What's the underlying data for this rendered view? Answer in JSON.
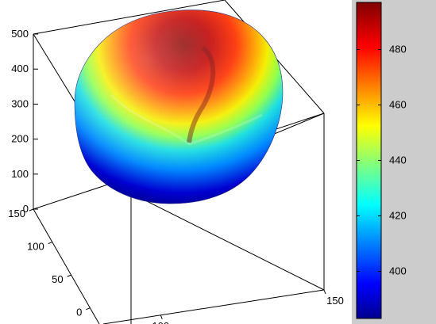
{
  "chart_data": {
    "type": "surface-3d",
    "title": "",
    "grid": false,
    "colormap": "jet",
    "z_axis": {
      "ticks": [
        "0",
        "100",
        "200",
        "300",
        "400",
        "500"
      ],
      "range": [
        0,
        500
      ]
    },
    "y_axis": {
      "ticks": [
        "0",
        "50",
        "100",
        "150"
      ],
      "range": [
        0,
        150
      ]
    },
    "x_axis": {
      "ticks": [
        "100",
        "150"
      ],
      "range": [
        0,
        150
      ]
    },
    "colorbar": {
      "ticks": [
        "400",
        "420",
        "440",
        "460",
        "480"
      ],
      "range": [
        383,
        497
      ]
    },
    "surface": {
      "shape": "hemispherical blob",
      "value_min": 383,
      "value_max": 497
    }
  },
  "colors": {
    "figure_background": "#cccccc",
    "axes_background": "#ffffff",
    "axis_lines": "#000000",
    "jet_stops": [
      "#00008f",
      "#0000ff",
      "#00ffff",
      "#ffff00",
      "#ff0000",
      "#800000"
    ]
  }
}
